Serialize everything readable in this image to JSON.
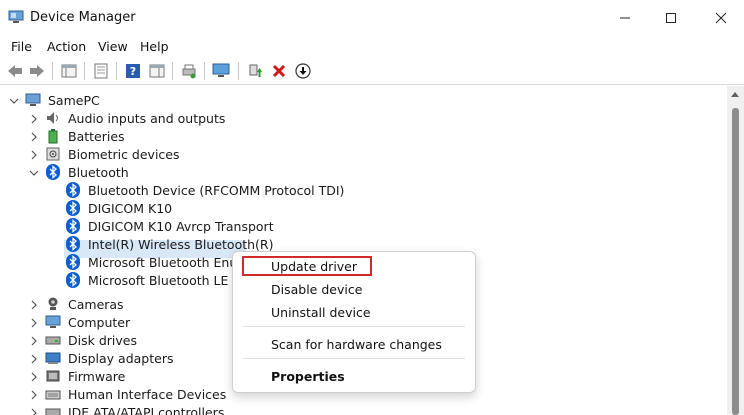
{
  "window": {
    "title": "Device Manager"
  },
  "menu": [
    "File",
    "Action",
    "View",
    "Help"
  ],
  "tree": {
    "root": "SamePC",
    "categories": [
      {
        "label": "Audio inputs and outputs",
        "icon": "speaker-icon"
      },
      {
        "label": "Batteries",
        "icon": "battery-icon"
      },
      {
        "label": "Biometric devices",
        "icon": "fingerprint-icon"
      },
      {
        "label": "Bluetooth",
        "icon": "bluetooth-icon"
      },
      {
        "label": "Cameras",
        "icon": "camera-icon"
      },
      {
        "label": "Computer",
        "icon": "monitor-icon"
      },
      {
        "label": "Disk drives",
        "icon": "disk-icon"
      },
      {
        "label": "Display adapters",
        "icon": "display-adapter-icon"
      },
      {
        "label": "Firmware",
        "icon": "firmware-icon"
      },
      {
        "label": "Human Interface Devices",
        "icon": "hid-icon"
      },
      {
        "label": "IDE ATA/ATAPI controllers",
        "icon": "ide-icon"
      }
    ],
    "bluetooth_devices": [
      "Bluetooth Device (RFCOMM Protocol TDI)",
      "DIGICOM K10",
      "DIGICOM K10 Avrcp Transport",
      "Intel(R) Wireless Bluetooth(R)",
      "Microsoft Bluetooth Enumerator",
      "Microsoft Bluetooth LE Enumerator"
    ]
  },
  "context_menu": {
    "update": "Update driver",
    "disable": "Disable device",
    "uninstall": "Uninstall device",
    "scan": "Scan for hardware changes",
    "properties": "Properties"
  },
  "colors": {
    "highlight_box": "#d12a2a",
    "selection": "#d9e8f7",
    "bluetooth": "#0a5fd1"
  }
}
